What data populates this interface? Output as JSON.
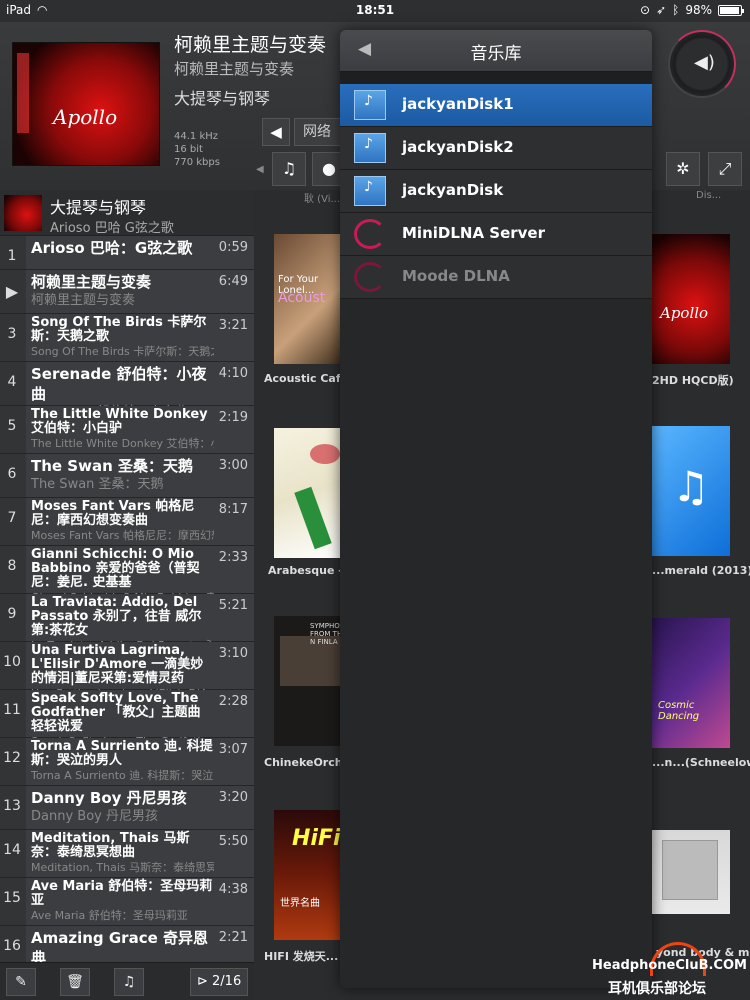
{
  "status": {
    "device": "iPad",
    "time": "18:51",
    "battery": "98%"
  },
  "now_playing": {
    "title": "柯赖里主题与变奏",
    "subtitle": "柯赖里主题与变奏",
    "album": "大提琴与钢琴",
    "sample_rate": "44.1 kHz",
    "bit_depth": "16 bit",
    "bitrate": "770 kbps",
    "cover_text": "Apollo"
  },
  "toolbar": {
    "network_label": "网络"
  },
  "queue": {
    "album_title": "大提琴与钢琴",
    "album_sub": "Arioso 巴哈 G弦之歌",
    "items": [
      {
        "num": "1",
        "line1": "Arioso 巴哈：G弦之歌",
        "line2": "",
        "dur": "0:59",
        "big": true
      },
      {
        "num": "▶",
        "line1": "柯赖里主题与变奏",
        "line2": "柯赖里主题与变奏",
        "dur": "6:49",
        "big": true
      },
      {
        "num": "3",
        "line1": "Song Of The Birds 卡萨尔斯：天鹅之歌",
        "line2": "Song Of The Birds 卡萨尔斯：天鹅之歌",
        "dur": "3:21",
        "big": false
      },
      {
        "num": "4",
        "line1": "Serenade 舒伯特：小夜曲",
        "line2": "Serenade 舒伯特：小夜曲",
        "dur": "4:10",
        "big": true
      },
      {
        "num": "5",
        "line1": "The Little White Donkey 艾伯特：小白驴",
        "line2": "The Little White Donkey 艾伯特：小白驴",
        "dur": "2:19",
        "big": false
      },
      {
        "num": "6",
        "line1": "The Swan 圣桑：天鹅",
        "line2": "The Swan 圣桑：天鹅",
        "dur": "3:00",
        "big": true
      },
      {
        "num": "7",
        "line1": "Moses Fant Vars 帕格尼尼：摩西幻想变奏曲",
        "line2": "Moses Fant Vars 帕格尼尼：摩西幻想变奏曲",
        "dur": "8:17",
        "big": false
      },
      {
        "num": "8",
        "line1": "Gianni Schicchi: O Mio Babbino 亲爱的爸爸（普契尼：姜尼. 史基基",
        "line2": "Gianni Schicchi: O Mio Babbino 亲爱的爸爸（...",
        "dur": "2:33",
        "big": false
      },
      {
        "num": "9",
        "line1": "La Traviata: Addio, Del Passato 永别了，往昔 威尔第:茶花女",
        "line2": "La Traviata: Addio, Del Passato 永别了，往昔...",
        "dur": "5:21",
        "big": false
      },
      {
        "num": "10",
        "line1": "Una Furtiva Lagrima, L'Elisir D'Amore 一滴美妙的情泪|董尼采第:爱情灵药",
        "line2": "Una Furtiva Lagrima, L'Elisir D'Amore 一滴美...",
        "dur": "3:10",
        "big": false
      },
      {
        "num": "11",
        "line1": "Speak Soflty Love, The Godfather 「教父」主题曲 轻轻说爱",
        "line2": "Speak Soflty Love, The Godfather 「教父」主...",
        "dur": "2:28",
        "big": false
      },
      {
        "num": "12",
        "line1": "Torna A Surriento 迪. 科提斯：哭泣的男人",
        "line2": "Torna A Surriento 迪. 科提斯：哭泣的男人",
        "dur": "3:07",
        "big": false
      },
      {
        "num": "13",
        "line1": "Danny Boy 丹尼男孩",
        "line2": "Danny Boy 丹尼男孩",
        "dur": "3:20",
        "big": true
      },
      {
        "num": "14",
        "line1": "Meditation, Thais 马斯奈：泰绮思冥想曲",
        "line2": "Meditation, Thais 马斯奈：泰绮思冥想曲",
        "dur": "5:50",
        "big": false
      },
      {
        "num": "15",
        "line1": "Ave Maria 舒伯特：圣母玛莉亚",
        "line2": "Ave Maria 舒伯特：圣母玛莉亚",
        "dur": "4:38",
        "big": false
      },
      {
        "num": "16",
        "line1": "Amazing Grace 奇异恩典",
        "line2": "Amazing Grace 奇异恩典",
        "dur": "2:21",
        "big": true
      }
    ]
  },
  "bottombar": {
    "count": "2/16"
  },
  "albums": {
    "left": [
      {
        "label": "Acoustic Cafe...",
        "cover_line1": "For Your Lonel...",
        "cover_line2": "Acoust"
      },
      {
        "label": "Arabesque - T...",
        "cover_line1": "",
        "cover_line2": ""
      },
      {
        "label": "ChinekeOrche...",
        "cover_line1": "SYMPHONY FROM THE N FINLA",
        "cover_line2": ""
      },
      {
        "label": "HIFI 发烧天...",
        "cover_line1": "HiFi",
        "cover_line2": "世界名曲"
      }
    ],
    "right": [
      {
        "label": "2HD HQCD版)",
        "cover_line1": "Apollo"
      },
      {
        "label": "...merald (2013)",
        "cover_line1": "♫"
      },
      {
        "label": "...n...(Schneelowe)",
        "cover_line1": "Cosmic Dancing"
      },
      {
        "label": "yond body & mind",
        "cover_line1": ""
      }
    ],
    "top_left_text": "耿 (Vi...)",
    "top_right_text": "Dis..."
  },
  "library": {
    "title": "音乐库",
    "items": [
      {
        "label": "jackyanDisk1",
        "icon": "synology-icon",
        "selected": true
      },
      {
        "label": "jackyanDisk2",
        "icon": "synology-icon",
        "selected": false
      },
      {
        "label": "jackyanDisk",
        "icon": "synology-icon",
        "selected": false
      },
      {
        "label": "MiniDLNA Server",
        "icon": "debian-icon",
        "selected": false
      },
      {
        "label": "Moode DLNA",
        "icon": "debian-icon",
        "selected": false
      }
    ]
  },
  "watermark": {
    "line1": "HeadphoneCluB.COM",
    "line2": "耳机俱乐部论坛"
  }
}
